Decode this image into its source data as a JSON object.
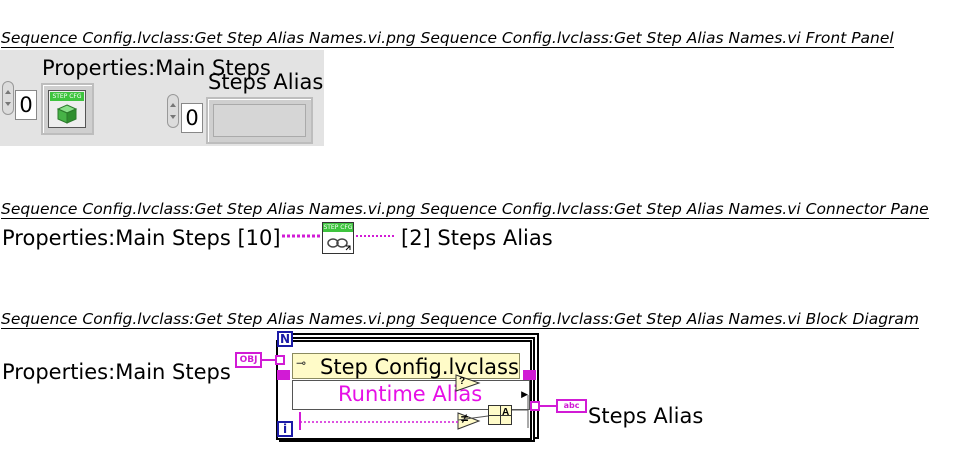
{
  "front_panel": {
    "heading": "Sequence Config.lvclass:Get Step Alias Names.vi.png  Sequence Config.lvclass:Get Step Alias Names.vi Front Panel",
    "main_steps_label": "Properties:Main Steps",
    "main_steps_index": "0",
    "main_steps_icon_text": "STEP CFG",
    "steps_alias_label": "Steps Alias",
    "steps_alias_index": "0"
  },
  "connector_pane": {
    "heading": "Sequence Config.lvclass:Get Step Alias Names.vi.png  Sequence Config.lvclass:Get Step Alias Names.vi Connector Pane",
    "input_label": "Properties:Main Steps [10]",
    "output_label": "[2] Steps Alias",
    "icon_text": "STEP CFG"
  },
  "block_diagram": {
    "heading": "Sequence Config.lvclass:Get Step Alias Names.vi.png  Sequence Config.lvclass:Get Step Alias Names.vi Block Diagram",
    "input_label": "Properties:Main Steps",
    "input_terminal": "OBJ",
    "loop_count": "N",
    "loop_iteration": "i",
    "unbundle_class": "Step Config.lvclass",
    "unbundle_field": "Runtime Alias",
    "output_terminal": "abc",
    "output_label": "Steps Alias",
    "compare_glyph": "≠",
    "check_glyph": "?",
    "build_glyph": "A"
  },
  "colors": {
    "wire_object": "#d11bd5",
    "wire_loop": "#1a1aa6",
    "unbundle_bg": "#fffbc8"
  }
}
